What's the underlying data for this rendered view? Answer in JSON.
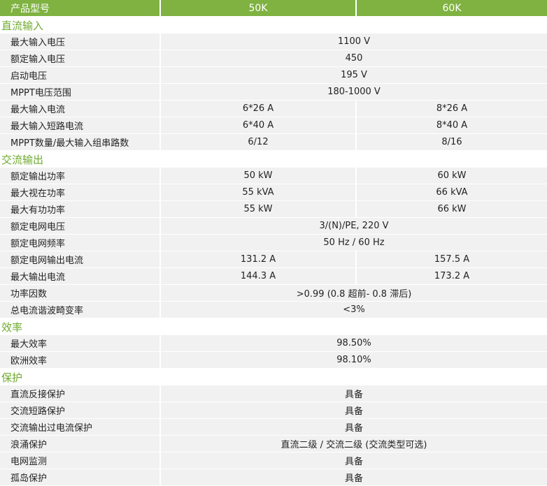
{
  "header": {
    "label": "产品型号",
    "col1": "50K",
    "col2": "60K"
  },
  "sections": [
    {
      "title": "直流输入",
      "rows": [
        {
          "label": "最大输入电压",
          "span": "1100 V"
        },
        {
          "label": "额定输入电压",
          "span": "450"
        },
        {
          "label": "启动电压",
          "span": "195 V"
        },
        {
          "label": "MPPT电压范围",
          "span": "180-1000 V"
        },
        {
          "label": "最大输入电流",
          "v1": "6*26 A",
          "v2": "8*26 A"
        },
        {
          "label": "最大输入短路电流",
          "v1": "6*40 A",
          "v2": "8*40 A"
        },
        {
          "label": "MPPT数量/最大输入组串路数",
          "v1": "6/12",
          "v2": "8/16"
        }
      ]
    },
    {
      "title": "交流输出",
      "rows": [
        {
          "label": "额定输出功率",
          "v1": "50 kW",
          "v2": "60 kW"
        },
        {
          "label": "最大视在功率",
          "v1": "55 kVA",
          "v2": "66 kVA"
        },
        {
          "label": "最大有功功率",
          "v1": "55 kW",
          "v2": "66 kW"
        },
        {
          "label": "额定电网电压",
          "span": "3/(N)/PE, 220 V"
        },
        {
          "label": "额定电网频率",
          "span": "50 Hz / 60 Hz"
        },
        {
          "label": "额定电网输出电流",
          "v1": "131.2 A",
          "v2": "157.5 A"
        },
        {
          "label": "最大输出电流",
          "v1": "144.3 A",
          "v2": "173.2 A"
        },
        {
          "label": "功率因数",
          "span": ">0.99 (0.8 超前- 0.8 滞后)"
        },
        {
          "label": "总电流谐波畸变率",
          "span": "<3%"
        }
      ]
    },
    {
      "title": "效率",
      "rows": [
        {
          "label": "最大效率",
          "span": "98.50%"
        },
        {
          "label": "欧洲效率",
          "span": "98.10%"
        }
      ]
    },
    {
      "title": "保护",
      "rows": [
        {
          "label": "直流反接保护",
          "span": "具备"
        },
        {
          "label": "交流短路保护",
          "span": "具备"
        },
        {
          "label": "交流输出过电流保护",
          "span": "具备"
        },
        {
          "label": "浪涌保护",
          "span": "直流二级 / 交流二级 (交流类型可选)"
        },
        {
          "label": "电网监测",
          "span": "具备"
        },
        {
          "label": "孤岛保护",
          "span": "具备"
        }
      ]
    }
  ]
}
